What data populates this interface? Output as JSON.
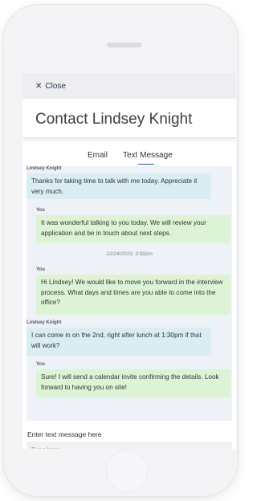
{
  "header": {
    "close_label": "Close",
    "close_icon": "close-icon",
    "title": "Contact Lindsey Knight"
  },
  "tabs": [
    {
      "label": "Email",
      "active": false
    },
    {
      "label": "Text Message",
      "active": true
    }
  ],
  "messages": [
    {
      "sender": "Lindsey Knight",
      "direction": "incoming",
      "text": "Thanks for taking time to talk with me today. Appreciate it very much."
    },
    {
      "sender": "You",
      "direction": "outgoing",
      "text": "It was wonderful talking to you today. We will review your application and be in touch about next steps."
    },
    {
      "timestamp": "12/24/2019, 3:00pm"
    },
    {
      "sender": "You",
      "direction": "outgoing",
      "text": "Hi Lindsey! We would like to move you forward in the interview process. What days and times are you able to come into the office?"
    },
    {
      "sender": "Lindsey Knight",
      "direction": "incoming",
      "text": "I can come in on the 2nd, right after lunch at 1:30pm if that will work?"
    },
    {
      "sender": "You",
      "direction": "outgoing",
      "text": "Sure! I will send a calendar invite confirming the details. Look forward to having you on site!"
    }
  ],
  "compose": {
    "label": "Enter text message here",
    "placeholder": "Type here"
  },
  "colors": {
    "incoming_bubble": "#d9edf2",
    "outgoing_bubble": "#ddf3d6",
    "thread_background": "#eef1f6",
    "accent": "#2f5b92"
  }
}
